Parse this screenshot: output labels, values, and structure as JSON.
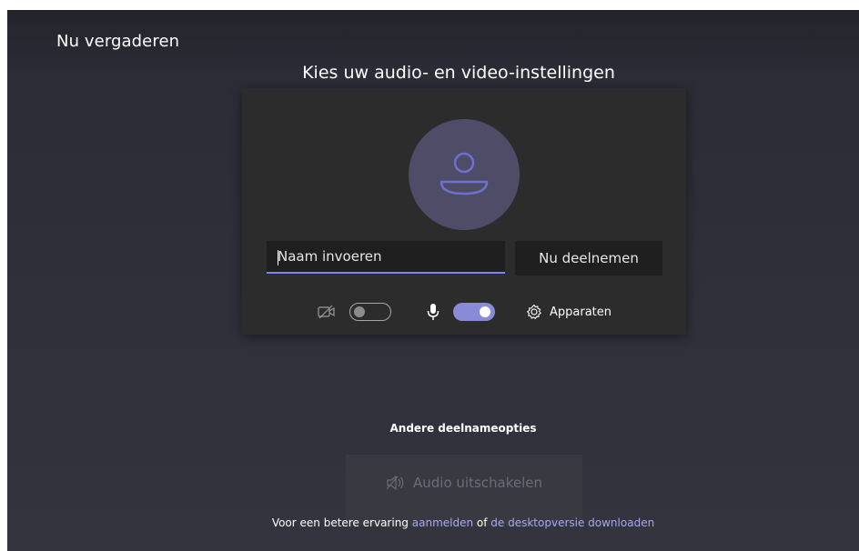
{
  "header": {
    "title": "Nu vergaderen"
  },
  "prejoin": {
    "heading": "Kies uw audio- en video-instellingen",
    "name_input": {
      "placeholder": "Naam invoeren",
      "value": ""
    },
    "join_label": "Nu deelnemen",
    "camera_toggle": {
      "state": "off"
    },
    "mic_toggle": {
      "state": "on"
    },
    "devices_label": "Apparaten",
    "avatar_icon": "person-icon"
  },
  "other_options": {
    "heading": "Andere deelnameopties",
    "audio_off_label": "Audio uitschakelen"
  },
  "footer": {
    "prefix": "Voor een betere ervaring ",
    "signin_link": "aanmelden",
    "middle": " of ",
    "download_link": "de desktopversie downloaden"
  },
  "colors": {
    "accent": "#7f85f5",
    "toggle_on": "#8a8bd6",
    "link": "#a6a7ee",
    "avatar_bg": "#4e4c67"
  }
}
